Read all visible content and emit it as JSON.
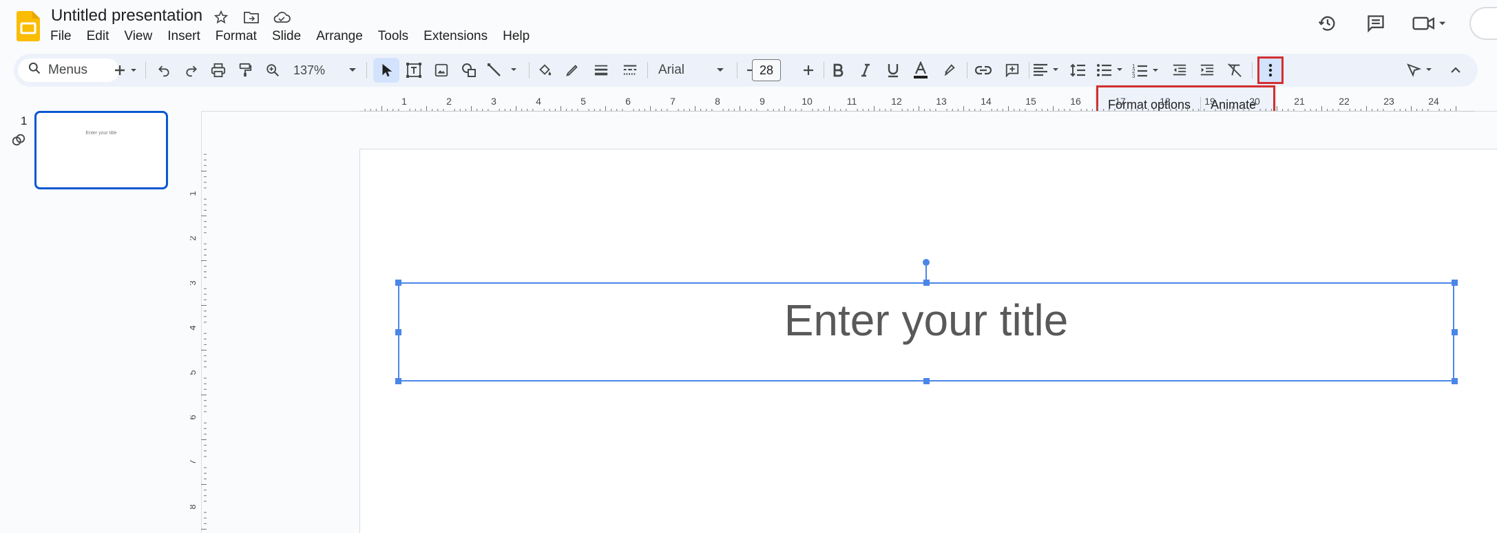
{
  "app": {
    "title": "Untitled presentation",
    "brand_color": "#fbbc04"
  },
  "menu": [
    "File",
    "Edit",
    "View",
    "Insert",
    "Format",
    "Slide",
    "Arrange",
    "Tools",
    "Extensions",
    "Help"
  ],
  "toolbar": {
    "search_label": "Menus",
    "zoom": "137%",
    "font": "Arial",
    "font_size": "28"
  },
  "popup": {
    "format_options": "Format options",
    "animate": "Animate"
  },
  "ruler": {
    "h_labels": [
      "1",
      "2",
      "3",
      "4",
      "5",
      "6",
      "7",
      "8",
      "9",
      "10",
      "11",
      "12",
      "13",
      "14",
      "15",
      "16",
      "17",
      "18",
      "19",
      "20",
      "21",
      "22",
      "23",
      "24",
      "2"
    ],
    "v_labels": [
      "1",
      "2",
      "3",
      "4",
      "5",
      "6",
      "7",
      "8"
    ]
  },
  "filmstrip": {
    "slide_number": "1",
    "thumb_text": "Enter your title"
  },
  "slide": {
    "title_placeholder": "Enter your title"
  },
  "colors": {
    "selection": "#4a86e8",
    "highlight_box": "#d32f2f",
    "toolbar_bg": "#edf2fa"
  }
}
